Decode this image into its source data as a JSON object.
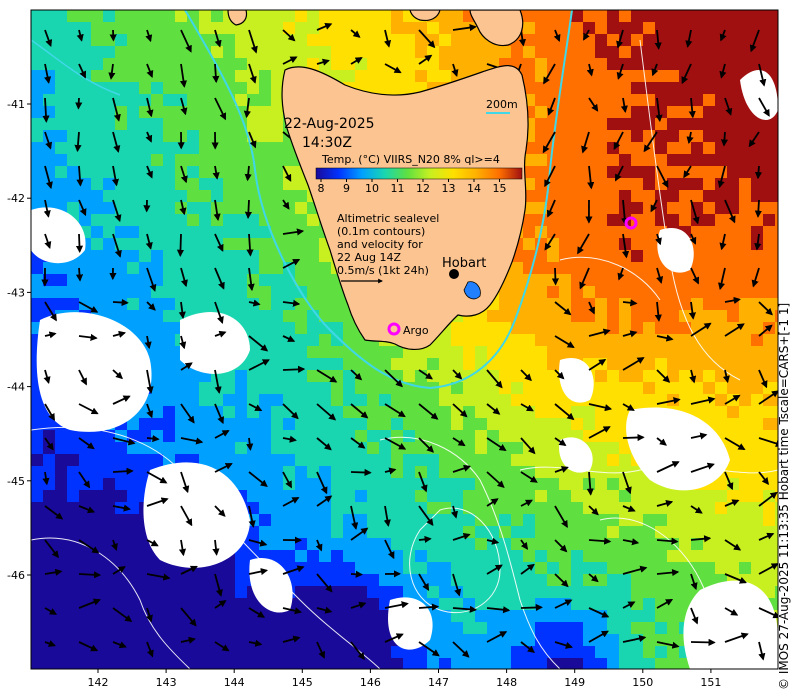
{
  "map": {
    "date": "22-Aug-2025",
    "time": "14:30Z",
    "product": "Temp. (°C) VIIRS_N20 8% ql>=4",
    "colorbar_ticks": [
      "8",
      "9",
      "10",
      "11",
      "12",
      "13",
      "14",
      "15"
    ],
    "colorbar_colors": [
      "#1a0a9a",
      "#0033ff",
      "#00a0ff",
      "#19d6b0",
      "#60e040",
      "#c8f020",
      "#ffe000",
      "#ffb000",
      "#ff7000",
      "#a01010"
    ],
    "depth_label": "200m",
    "altimetry_note": [
      "Altimetric sealevel",
      "(0.1m contours)",
      "and velocity for",
      "22 Aug 14Z",
      "0.5m/s (1kt 24h)"
    ],
    "places": {
      "hobart": "Hobart",
      "argo": "Argo"
    },
    "lon_ticks": [
      "142",
      "143",
      "144",
      "145",
      "146",
      "147",
      "148",
      "149",
      "150",
      "151"
    ],
    "lat_ticks": [
      "-41",
      "-42",
      "-43",
      "-44",
      "-45",
      "-46"
    ],
    "side_note": "© IMOS 27-Aug-2025 11:13:35 Hobart time Tscale=CARS+[-1 1]",
    "colors": {
      "land": "#fcc490",
      "isobath": "#40d8e8",
      "argo_marker": "#ff00ff",
      "contour": "#ffffff"
    }
  }
}
